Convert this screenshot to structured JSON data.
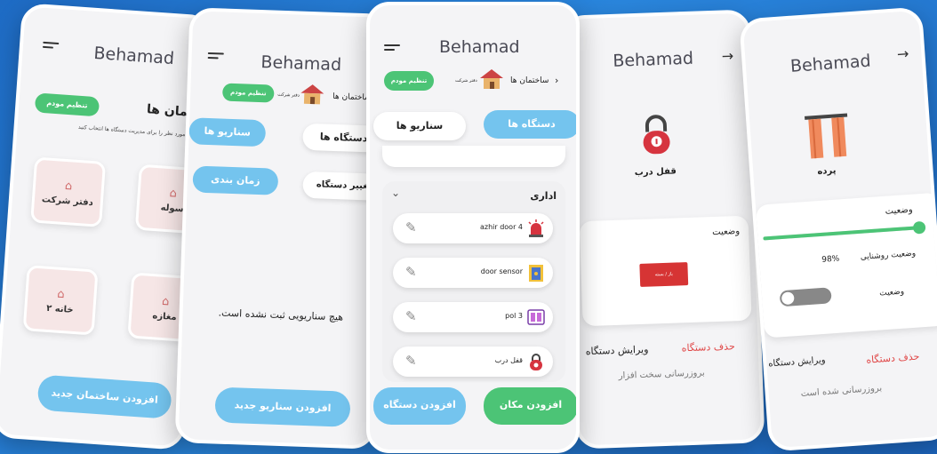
{
  "brand": "Behamad",
  "phone1": {
    "title": "ساختمان ها",
    "modem_button": "تنظیم مودم",
    "subtitle": "ساختمان مورد نظر را برای مدیریت دستگاه ها انتخاب کنید",
    "tiles": [
      "دفتر شرکت",
      "سوله",
      "خانه ۲",
      "مغازه"
    ],
    "add_button": "افزودن ساختمان جدید"
  },
  "phone2": {
    "modem_button": "تنظیم مودم",
    "breadcrumb_place": "دفتر شرکت",
    "breadcrumb_buildings": "ساختمان ها",
    "tab_scenarios": "سناریو ها",
    "tab_devices": "دستگاه ها",
    "tab_schedule": "زمان بندی",
    "tab_change_device": "تغییر دستگاه",
    "empty_message": "هیچ سناریویی ثبت نشده است.",
    "add_button": "افزودن سناریو جدید"
  },
  "phone3": {
    "modem_button": "تنظیم مودم",
    "breadcrumb_place": "دفتر شرکت",
    "breadcrumb_buildings": "ساختمان ها",
    "tab_scenarios": "سناریو ها",
    "tab_devices": "دستگاه ها",
    "section_title": "اداری",
    "devices": [
      "azhir door 4",
      "door sensor",
      "pol 3",
      "قفل درب"
    ],
    "add_device_button": "افزودن دستگاه",
    "add_place_button": "افزودن مکان"
  },
  "phone4": {
    "device_name": "قفل درب",
    "status_label": "وضعیت",
    "status_button": "باز / بسته",
    "delete_device": "حذف دستگاه",
    "edit_device": "ویرایش دستگاه",
    "update_hardware": "بروزرسانی سخت افزار"
  },
  "phone5": {
    "device_name": "پرده",
    "status_label": "وضعیت",
    "brightness_label": "وضعیت روشنایی",
    "brightness_value": "98%",
    "brightness_fraction": 0.98,
    "toggle_label": "وضعیت",
    "delete_device": "حذف دستگاه",
    "edit_device": "ویرایش دستگاه",
    "updated_text": "بروزرسانی شده است"
  },
  "colors": {
    "background": "#2a86dd",
    "green": "#4cc476",
    "blue": "#74c4ee",
    "delete_red": "#e04848",
    "lock_red": "#d6343f"
  }
}
